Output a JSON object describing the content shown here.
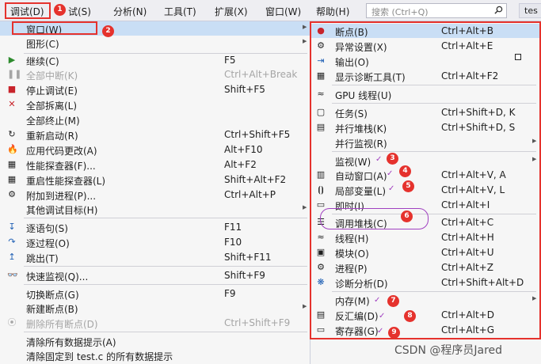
{
  "menubar": {
    "items": [
      "调试(D)",
      "试(S)",
      "分析(N)",
      "工具(T)",
      "扩展(X)",
      "窗口(W)",
      "帮助(H)"
    ],
    "search_placeholder": "搜索 (Ctrl+Q)",
    "tab": "tes"
  },
  "debug_menu": [
    {
      "label": "窗口(W)",
      "shortcut": "",
      "submenu": true
    },
    {
      "label": "图形(C)",
      "shortcut": "",
      "submenu": true
    },
    {
      "label": "继续(C)",
      "shortcut": "F5"
    },
    {
      "label": "全部中断(K)",
      "shortcut": "Ctrl+Alt+Break"
    },
    {
      "label": "停止调试(E)",
      "shortcut": "Shift+F5"
    },
    {
      "label": "全部拆离(L)",
      "shortcut": ""
    },
    {
      "label": "全部终止(M)",
      "shortcut": ""
    },
    {
      "label": "重新启动(R)",
      "shortcut": "Ctrl+Shift+F5"
    },
    {
      "label": "应用代码更改(A)",
      "shortcut": "Alt+F10"
    },
    {
      "label": "性能探查器(F)...",
      "shortcut": "Alt+F2"
    },
    {
      "label": "重启性能探查器(L)",
      "shortcut": "Shift+Alt+F2"
    },
    {
      "label": "附加到进程(P)...",
      "shortcut": "Ctrl+Alt+P"
    },
    {
      "label": "其他调试目标(H)",
      "shortcut": "",
      "submenu": true
    },
    {
      "label": "逐语句(S)",
      "shortcut": "F11"
    },
    {
      "label": "逐过程(O)",
      "shortcut": "F10"
    },
    {
      "label": "跳出(T)",
      "shortcut": "Shift+F11"
    },
    {
      "label": "快速监视(Q)...",
      "shortcut": "Shift+F9"
    },
    {
      "label": "切换断点(G)",
      "shortcut": "F9"
    },
    {
      "label": "新建断点(B)",
      "shortcut": "",
      "submenu": true
    },
    {
      "label": "删除所有断点(D)",
      "shortcut": "Ctrl+Shift+F9"
    },
    {
      "label": "清除所有数据提示(A)",
      "shortcut": ""
    },
    {
      "label": "清除固定到 test.c 的所有数据提示",
      "shortcut": ""
    }
  ],
  "window_submenu": [
    {
      "label": "断点(B)",
      "shortcut": "Ctrl+Alt+B"
    },
    {
      "label": "异常设置(X)",
      "shortcut": "Ctrl+Alt+E"
    },
    {
      "label": "输出(O)",
      "shortcut": ""
    },
    {
      "label": "显示诊断工具(T)",
      "shortcut": "Ctrl+Alt+F2"
    },
    {
      "label": "GPU 线程(U)",
      "shortcut": ""
    },
    {
      "label": "任务(S)",
      "shortcut": "Ctrl+Shift+D, K"
    },
    {
      "label": "并行堆栈(K)",
      "shortcut": "Ctrl+Shift+D, S"
    },
    {
      "label": "并行监视(R)",
      "shortcut": "",
      "submenu": true
    },
    {
      "label": "监视(W)",
      "shortcut": "",
      "submenu": true
    },
    {
      "label": "自动窗口(A)",
      "shortcut": "Ctrl+Alt+V, A"
    },
    {
      "label": "局部变量(L)",
      "shortcut": "Ctrl+Alt+V, L"
    },
    {
      "label": "即时(I)",
      "shortcut": "Ctrl+Alt+I"
    },
    {
      "label": "调用堆栈(C)",
      "shortcut": "Ctrl+Alt+C"
    },
    {
      "label": "线程(H)",
      "shortcut": "Ctrl+Alt+H"
    },
    {
      "label": "模块(O)",
      "shortcut": "Ctrl+Alt+U"
    },
    {
      "label": "进程(P)",
      "shortcut": "Ctrl+Alt+Z"
    },
    {
      "label": "诊断分析(D)",
      "shortcut": "Ctrl+Shift+Alt+D"
    },
    {
      "label": "内存(M)",
      "shortcut": "",
      "submenu": true
    },
    {
      "label": "反汇编(D)",
      "shortcut": "Ctrl+Alt+D"
    },
    {
      "label": "寄存器(G)",
      "shortcut": "Ctrl+Alt+G"
    }
  ],
  "badges": [
    "1",
    "2",
    "3",
    "4",
    "5",
    "6",
    "7",
    "8",
    "9"
  ],
  "watermark": "CSDN @程序员Jared",
  "colors": {
    "highlight": "#c9def5",
    "annotation_red": "#e5322d",
    "annotation_purple": "#a040c0"
  }
}
